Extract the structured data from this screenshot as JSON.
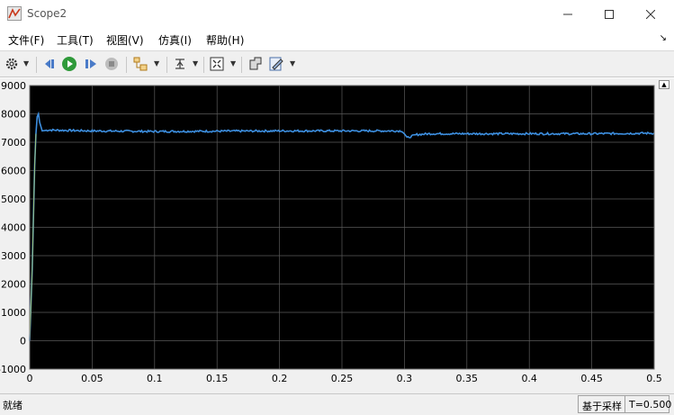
{
  "window": {
    "title": "Scope2"
  },
  "menu": {
    "items": [
      "文件(F)",
      "工具(T)",
      "视图(V)",
      "仿真(I)",
      "帮助(H)"
    ]
  },
  "toolbar": {
    "icons": [
      "gear-icon",
      "step-back-icon",
      "run-icon",
      "step-forward-icon",
      "stop-icon",
      "highlight-block-icon",
      "triggers-icon",
      "autoscale-icon",
      "cursor-measure-icon",
      "style-icon"
    ]
  },
  "status": {
    "ready": "就绪",
    "sample_mode": "基于采样",
    "time": "T=0.500"
  },
  "colors": {
    "plot_bg": "#000000",
    "grid": "#5a5a5a",
    "signal": "#3d8fe0",
    "transient_alt": "#c8d84a"
  },
  "chart_data": {
    "type": "line",
    "xlim": [
      0,
      0.5
    ],
    "ylim": [
      -1000,
      9000
    ],
    "x_ticks": [
      "0",
      "0.05",
      "0.1",
      "0.15",
      "0.2",
      "0.25",
      "0.3",
      "0.35",
      "0.4",
      "0.45",
      "0.5"
    ],
    "y_ticks": [
      "-1000",
      "0",
      "1000",
      "2000",
      "3000",
      "4000",
      "5000",
      "6000",
      "7000",
      "8000",
      "9000"
    ],
    "grid": true,
    "series": [
      {
        "x": [
          0,
          0.002,
          0.004,
          0.005,
          0.006,
          0.007,
          0.008,
          0.01,
          0.015,
          0.05,
          0.1,
          0.2,
          0.298,
          0.3,
          0.302,
          0.305,
          0.31,
          0.32,
          0.35,
          0.4,
          0.45,
          0.5
        ],
        "y": [
          0,
          2500,
          6200,
          7300,
          7900,
          8000,
          7700,
          7400,
          7430,
          7400,
          7380,
          7400,
          7400,
          7300,
          7150,
          7200,
          7270,
          7300,
          7300,
          7300,
          7300,
          7320
        ]
      }
    ]
  }
}
